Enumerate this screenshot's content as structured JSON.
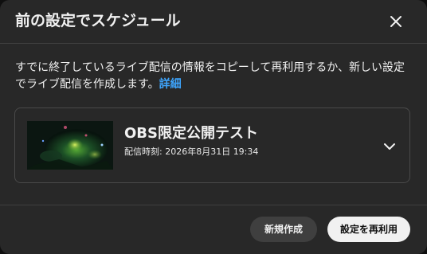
{
  "dialog": {
    "title": "前の設定でスケジュール",
    "close_icon": "close-icon",
    "description": "すでに終了しているライブ配信の情報をコピーして再利用するか、新しい設定でライブ配信を作成します。",
    "details_link": "詳細"
  },
  "stream": {
    "title": "OBS限定公開テスト",
    "time": "配信時刻: 2026年8月31日 19:34",
    "thumbnail_icon": "stream-thumbnail",
    "expand_icon": "chevron-down-icon"
  },
  "footer": {
    "new_button": "新規作成",
    "reuse_button": "設定を再利用"
  },
  "colors": {
    "dialog_bg": "#282828",
    "link": "#3ea6ff",
    "primary_button_bg": "#f1f1f1",
    "secondary_button_bg": "#3f3f3f"
  }
}
